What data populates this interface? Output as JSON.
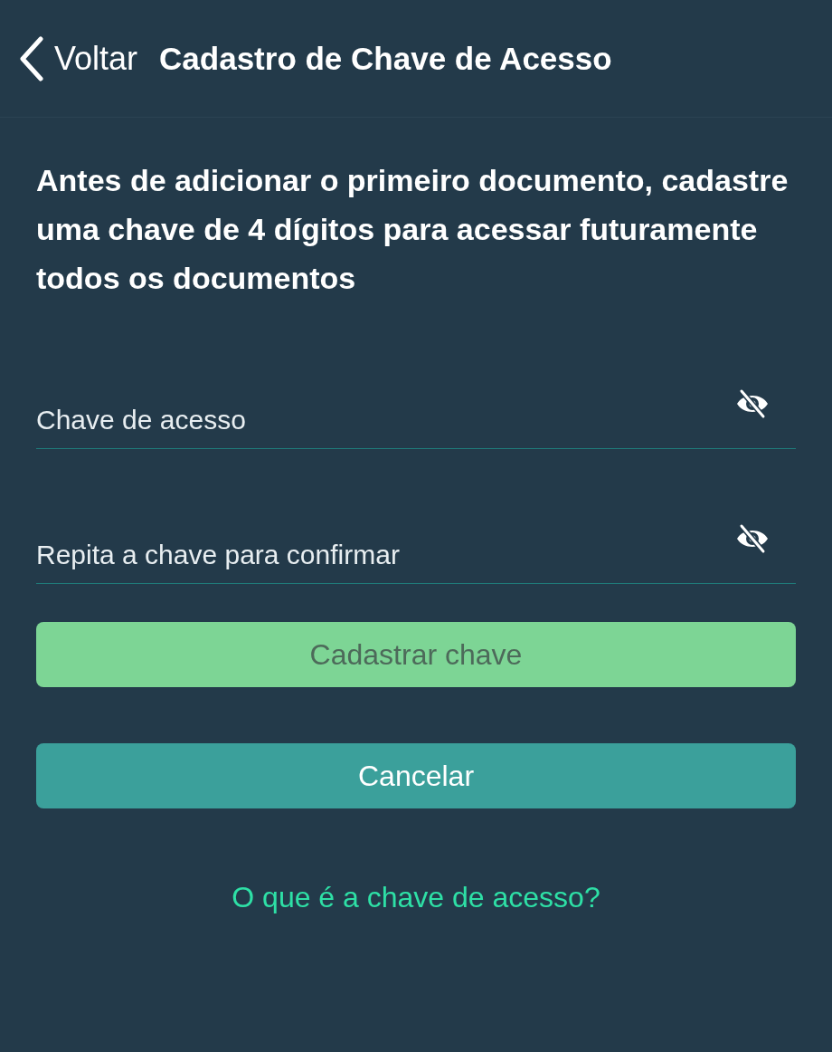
{
  "nav_bar": {
    "back_label": "Voltar",
    "title": "Cadastro de Chave de Acesso"
  },
  "intro": "Antes de adicionar o primeiro documento, cadastre uma chave de 4 dígitos para acessar futuramente todos os documentos",
  "fields": [
    {
      "placeholder": "Chave de acesso",
      "hidden": true
    },
    {
      "placeholder": "Repita a chave para confirmar",
      "hidden": true
    }
  ],
  "buttons": [
    {
      "label": "Cadastrar chave",
      "kind": "primary",
      "disabled": true
    },
    {
      "label": "Cancelar",
      "kind": "secondary",
      "disabled": false
    }
  ],
  "help_link": "O que é a chave de acesso?"
}
